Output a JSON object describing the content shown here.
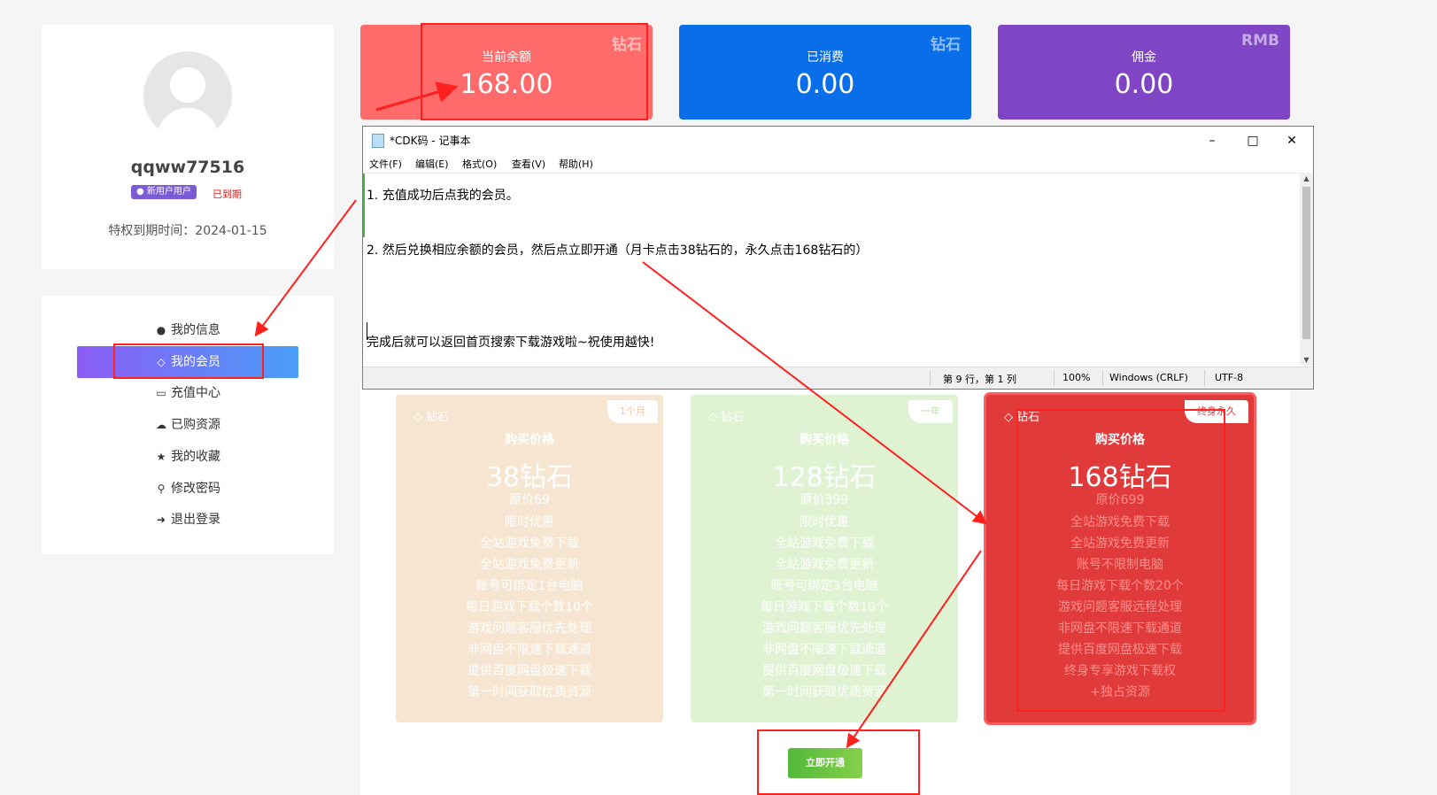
{
  "profile": {
    "username": "qqww77516",
    "badge_new": "新用户用户",
    "badge_expired": "已到期",
    "expiry": "特权到期时间：2024-01-15"
  },
  "menu": [
    {
      "label": "我的信息",
      "icon": "user-icon"
    },
    {
      "label": "我的会员",
      "icon": "diamond-icon",
      "active": true
    },
    {
      "label": "充值中心",
      "icon": "credit-card-icon"
    },
    {
      "label": "已购资源",
      "icon": "cloud-download-icon"
    },
    {
      "label": "我的收藏",
      "icon": "star-icon"
    },
    {
      "label": "修改密码",
      "icon": "key-icon"
    },
    {
      "label": "退出登录",
      "icon": "logout-icon"
    }
  ],
  "stats": [
    {
      "label": "当前余额",
      "value": "168.00",
      "unit": "钻石",
      "color": "#ff6b6b"
    },
    {
      "label": "已消费",
      "value": "0.00",
      "unit": "钻石",
      "color": "#0a6ee8"
    },
    {
      "label": "佣金",
      "value": "0.00",
      "unit": "RMB",
      "color": "#7f45c4"
    }
  ],
  "plans": [
    {
      "logo": "钻石",
      "tag": "1个月",
      "title": "购买价格",
      "price": "38钻石",
      "original": "原价69",
      "features": [
        "限时优惠",
        "全站游戏免费下载",
        "全站游戏免费更新",
        "账号可绑定1台电脑",
        "每日游戏下载个数10个",
        "游戏问题客服优先处理",
        "非网盘不限速下载通道",
        "提供百度网盘极速下载",
        "第一时间获取优质资源"
      ]
    },
    {
      "logo": "钻石",
      "tag": "一年",
      "title": "购买价格",
      "price": "128钻石",
      "original": "原价399",
      "features": [
        "限时优惠",
        "全站游戏免费下载",
        "全站游戏免费更新",
        "账号可绑定3台电脑",
        "每日游戏下载个数10个",
        "游戏问题客服优先处理",
        "非网盘不限速下载通道",
        "提供百度网盘极速下载",
        "第一时间获取优质资源"
      ]
    },
    {
      "logo": "钻石",
      "tag": "终身永久",
      "title": "购买价格",
      "price": "168钻石",
      "original": "原价699",
      "features": [
        "全站游戏免费下载",
        "全站游戏免费更新",
        "账号不限制电脑",
        "每日游戏下载个数20个",
        "游戏问题客服远程处理",
        "非网盘不限速下载通道",
        "提供百度网盘极速下载",
        "终身专享游戏下载权",
        "+独占资源"
      ]
    }
  ],
  "open_button": "立即开通",
  "notepad": {
    "title": "*CDK码 - 记事本",
    "menu": [
      "文件(F)",
      "编辑(E)",
      "格式(O)",
      "查看(V)",
      "帮助(H)"
    ],
    "lines": [
      "1. 充值成功后点我的会员。",
      "2. 然后兑换相应余额的会员，然后点立即开通（月卡点击38钻石的，永久点击168钻石的）",
      "完成后就可以返回首页搜索下载游戏啦~祝使用越快!"
    ],
    "status": {
      "position": "第 9 行，第 1 列",
      "zoom": "100%",
      "line_ending": "Windows (CRLF)",
      "encoding": "UTF-8"
    }
  }
}
